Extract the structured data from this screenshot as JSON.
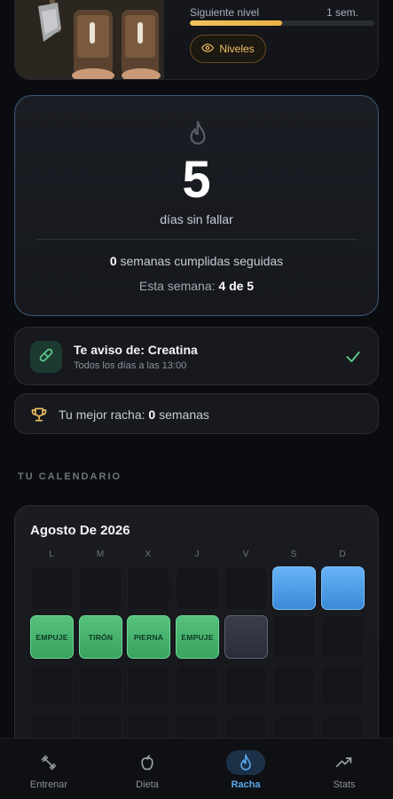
{
  "level": {
    "next_label": "Siguiente nivel",
    "next_value": "1 sem.",
    "progress": 0.5,
    "levels_button": "Niveles"
  },
  "streak": {
    "days": "5",
    "days_label": "días sin fallar",
    "weeks_count": "0",
    "weeks_text": " semanas cumplidas seguidas",
    "this_week_label": "Esta semana: ",
    "this_week_value": "4 de 5"
  },
  "reminder": {
    "title": "Te aviso de: Creatina",
    "subtitle": "Todos los días a las 13:00"
  },
  "best": {
    "label": "Tu mejor racha: ",
    "value": "0",
    "suffix": " semanas"
  },
  "calendar": {
    "section_title": "TU CALENDARIO",
    "month": "Agosto De 2026",
    "weekdays": [
      "L",
      "M",
      "X",
      "J",
      "V",
      "S",
      "D"
    ],
    "rows": [
      [
        {
          "type": "empty",
          "label": ""
        },
        {
          "type": "empty",
          "label": ""
        },
        {
          "type": "empty",
          "label": ""
        },
        {
          "type": "empty",
          "label": ""
        },
        {
          "type": "empty",
          "label": ""
        },
        {
          "type": "blue",
          "label": ""
        },
        {
          "type": "blue",
          "label": ""
        }
      ],
      [
        {
          "type": "green",
          "label": "EMPUJE"
        },
        {
          "type": "green",
          "label": "TIRÓN"
        },
        {
          "type": "green",
          "label": "PIERNA"
        },
        {
          "type": "green",
          "label": "EMPUJE"
        },
        {
          "type": "today",
          "label": ""
        },
        {
          "type": "empty",
          "label": ""
        },
        {
          "type": "empty",
          "label": ""
        }
      ],
      [
        {
          "type": "empty",
          "label": ""
        },
        {
          "type": "empty",
          "label": ""
        },
        {
          "type": "empty",
          "label": ""
        },
        {
          "type": "empty",
          "label": ""
        },
        {
          "type": "empty",
          "label": ""
        },
        {
          "type": "empty",
          "label": ""
        },
        {
          "type": "empty",
          "label": ""
        }
      ],
      [
        {
          "type": "empty",
          "label": ""
        },
        {
          "type": "empty",
          "label": ""
        },
        {
          "type": "empty",
          "label": ""
        },
        {
          "type": "empty",
          "label": ""
        },
        {
          "type": "empty",
          "label": ""
        },
        {
          "type": "empty",
          "label": ""
        },
        {
          "type": "empty",
          "label": ""
        }
      ]
    ]
  },
  "nav": {
    "items": [
      {
        "label": "Entrenar",
        "icon": "dumbbell-icon",
        "active": false
      },
      {
        "label": "Dieta",
        "icon": "apple-icon",
        "active": false
      },
      {
        "label": "Racha",
        "icon": "flame-icon",
        "active": true
      },
      {
        "label": "Stats",
        "icon": "trend-up-icon",
        "active": false
      }
    ]
  },
  "colors": {
    "accent_blue": "#5aa9f0",
    "gold": "#f0c064",
    "green": "#56c27e"
  }
}
